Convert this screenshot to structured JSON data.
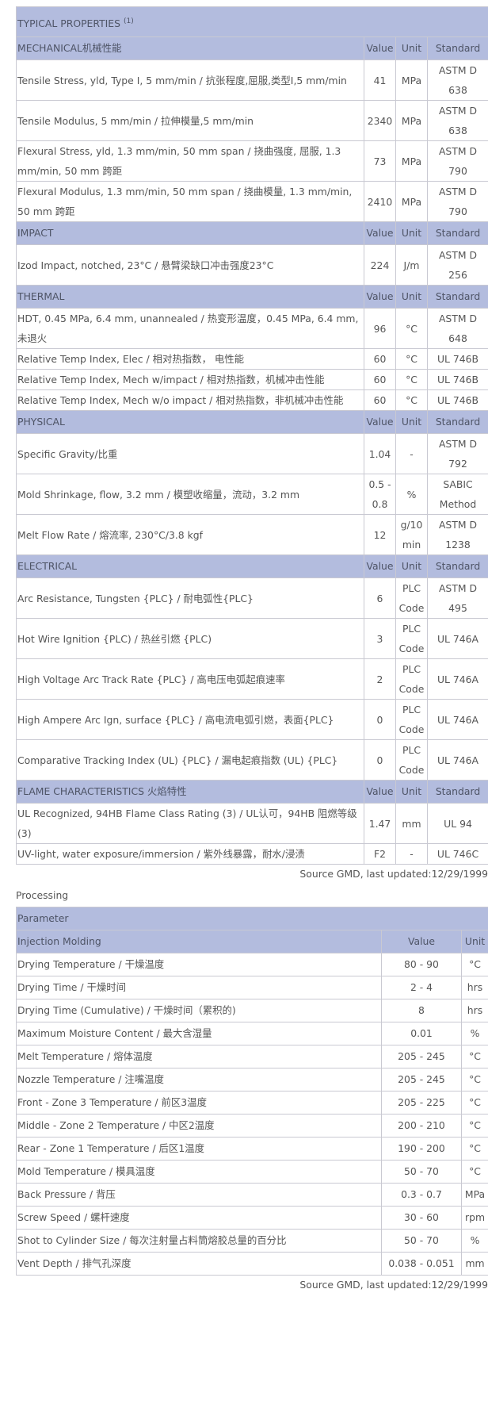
{
  "properties": {
    "title": "TYPICAL PROPERTIES",
    "title_sup": "(1)",
    "sections": [
      {
        "name": "MECHANICAL机械性能",
        "col_value": "Value",
        "col_unit": "Unit",
        "col_standard": "Standard",
        "rows": [
          {
            "property": "Tensile Stress, yld, Type I, 5 mm/min / 抗张程度,屈服,类型I,5 mm/min",
            "value": "41",
            "unit": "MPa",
            "standard": "ASTM D 638"
          },
          {
            "property": "Tensile Modulus, 5 mm/min / 拉伸模量,5 mm/min",
            "value": "2340",
            "unit": "MPa",
            "standard": "ASTM D 638"
          },
          {
            "property": "Flexural Stress, yld, 1.3 mm/min, 50 mm span / 挠曲强度, 屈服, 1.3 mm/min, 50 mm 跨距",
            "value": "73",
            "unit": "MPa",
            "standard": "ASTM D 790"
          },
          {
            "property": "Flexural Modulus, 1.3 mm/min, 50 mm span / 挠曲模量, 1.3 mm/min, 50 mm 跨距",
            "value": "2410",
            "unit": "MPa",
            "standard": "ASTM D 790"
          }
        ]
      },
      {
        "name": "IMPACT",
        "col_value": "Value",
        "col_unit": "Unit",
        "col_standard": "Standard",
        "rows": [
          {
            "property": "Izod Impact, notched, 23°C / 悬臂梁缺口冲击强度23°C",
            "value": "224",
            "unit": "J/m",
            "standard": "ASTM D 256"
          }
        ]
      },
      {
        "name": "THERMAL",
        "col_value": "Value",
        "col_unit": "Unit",
        "col_standard": "Standard",
        "rows": [
          {
            "property": "HDT, 0.45 MPa, 6.4 mm, unannealed / 热变形温度，0.45 MPa, 6.4 mm, 未退火",
            "value": "96",
            "unit": "°C",
            "standard": "ASTM D 648"
          },
          {
            "property": "Relative Temp Index, Elec / 相对热指数， 电性能",
            "value": "60",
            "unit": "°C",
            "standard": "UL 746B"
          },
          {
            "property": "Relative Temp Index, Mech w/impact / 相对热指数，机械冲击性能",
            "value": "60",
            "unit": "°C",
            "standard": "UL 746B"
          },
          {
            "property": "Relative Temp Index, Mech w/o impact / 相对热指数，非机械冲击性能",
            "value": "60",
            "unit": "°C",
            "standard": "UL 746B"
          }
        ]
      },
      {
        "name": "PHYSICAL",
        "col_value": "Value",
        "col_unit": "Unit",
        "col_standard": "Standard",
        "rows": [
          {
            "property": "Specific Gravity/比重",
            "value": "1.04",
            "unit": "-",
            "standard": "ASTM D 792"
          },
          {
            "property": "Mold Shrinkage, flow, 3.2 mm / 模塑收缩量，流动，3.2 mm",
            "value": "0.5 - 0.8",
            "unit": "%",
            "standard": "SABIC Method"
          },
          {
            "property": "Melt Flow Rate / 熔流率, 230°C/3.8 kgf",
            "value": "12",
            "unit": "g/10 min",
            "standard": "ASTM D 1238"
          }
        ]
      },
      {
        "name": "ELECTRICAL",
        "col_value": "Value",
        "col_unit": "Unit",
        "col_standard": "Standard",
        "rows": [
          {
            "property": "Arc Resistance, Tungsten {PLC} / 耐电弧性{PLC}",
            "value": "6",
            "unit": "PLC Code",
            "standard": "ASTM D 495"
          },
          {
            "property": "Hot Wire Ignition {PLC) / 热丝引燃 {PLC)",
            "value": "3",
            "unit": "PLC Code",
            "standard": "UL 746A"
          },
          {
            "property": "High Voltage Arc Track Rate {PLC} / 高电压电弧起痕速率",
            "value": "2",
            "unit": "PLC Code",
            "standard": "UL 746A"
          },
          {
            "property": "High Ampere Arc Ign, surface {PLC} / 高电流电弧引燃，表面{PLC}",
            "value": "0",
            "unit": "PLC Code",
            "standard": "UL 746A"
          },
          {
            "property": "Comparative Tracking Index (UL) {PLC} / 漏电起痕指数 (UL) {PLC}",
            "value": "0",
            "unit": "PLC Code",
            "standard": "UL 746A"
          }
        ]
      },
      {
        "name": "FLAME CHARACTERISTICS 火焰特性",
        "col_value": "Value",
        "col_unit": "Unit",
        "col_standard": "Standard",
        "rows": [
          {
            "property": "UL Recognized, 94HB Flame Class Rating (3) / UL认可，94HB 阻燃等级(3)",
            "value": "1.47",
            "unit": "mm",
            "standard": "UL 94"
          },
          {
            "property": "UV-light, water exposure/immersion / 紫外线暴露，耐水/浸渍",
            "value": "F2",
            "unit": "-",
            "standard": "UL 746C"
          }
        ]
      }
    ],
    "source": "Source GMD, last updated:12/29/1999"
  },
  "processing": {
    "label": "Processing",
    "parameter_header": "Parameter",
    "group_name": "Injection Molding",
    "col_value": "Value",
    "col_unit": "Unit",
    "rows": [
      {
        "parameter": "Drying Temperature / 干燥温度",
        "value": "80 - 90",
        "unit": "°C"
      },
      {
        "parameter": "Drying Time / 干燥时间",
        "value": "2 - 4",
        "unit": "hrs"
      },
      {
        "parameter": "Drying Time (Cumulative) / 干燥时间（累积的)",
        "value": "8",
        "unit": "hrs"
      },
      {
        "parameter": "Maximum Moisture Content / 最大含湿量",
        "value": "0.01",
        "unit": "%"
      },
      {
        "parameter": "Melt Temperature / 熔体温度",
        "value": "205 - 245",
        "unit": "°C"
      },
      {
        "parameter": "Nozzle Temperature / 注嘴温度",
        "value": "205 - 245",
        "unit": "°C"
      },
      {
        "parameter": "Front - Zone 3 Temperature / 前区3温度",
        "value": "205 - 225",
        "unit": "°C"
      },
      {
        "parameter": "Middle - Zone 2 Temperature / 中区2温度",
        "value": "200 - 210",
        "unit": "°C"
      },
      {
        "parameter": "Rear - Zone 1 Temperature / 后区1温度",
        "value": "190 - 200",
        "unit": "°C"
      },
      {
        "parameter": "Mold Temperature / 模具温度",
        "value": "50 - 70",
        "unit": "°C"
      },
      {
        "parameter": "Back Pressure / 背压",
        "value": "0.3 - 0.7",
        "unit": "MPa"
      },
      {
        "parameter": "Screw Speed / 螺杆速度",
        "value": "30 - 60",
        "unit": "rpm"
      },
      {
        "parameter": "Shot to Cylinder Size / 每次注射量占料筒熔胶总量的百分比",
        "value": "50 - 70",
        "unit": "%"
      },
      {
        "parameter": "Vent Depth / 排气孔深度",
        "value": "0.038 - 0.051",
        "unit": "mm"
      }
    ],
    "source": "Source GMD, last updated:12/29/1999"
  }
}
